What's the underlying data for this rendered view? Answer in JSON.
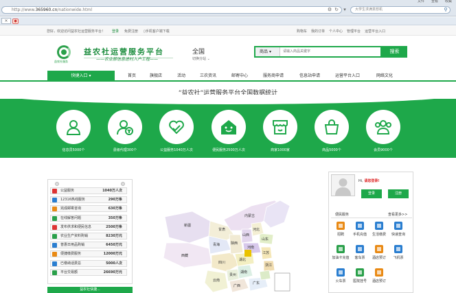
{
  "browser": {
    "menu": [
      "文件",
      "查看",
      "收藏"
    ],
    "url_prefix": "http://www.",
    "url_domain": "365960.cn",
    "url_path": "/nationwide.html",
    "search_placeholder": "大学生求满意想机",
    "fav_button": "×"
  },
  "topbar": {
    "welcome": "您好，欢迎访问益农社运营服务平台！",
    "login": "登录",
    "register": "免费注册",
    "app": "手机客户端下载",
    "right_links": [
      "购物车",
      "我的订单",
      "个人中心",
      "管理平台",
      "运营平台入口"
    ]
  },
  "header": {
    "logo_small": "益农社服务",
    "title": "益农社运营服务平台",
    "slogan": "——农业部信息进村入户工程——",
    "region": "全国",
    "region_switch": "切换分站"
  },
  "search": {
    "category": "商品",
    "placeholder": "请输入商品关键字",
    "button": "搜索"
  },
  "nav": {
    "quick": "快捷入口",
    "items": [
      "首页",
      "旗舰店",
      "活动",
      "三农资讯",
      "邮寄中心",
      "服务商申请",
      "信息站申请",
      "运营平台入口",
      "网络文化"
    ]
  },
  "stats": {
    "title": "“益农社“运营服务平台全国数据统计",
    "items": [
      {
        "label": "信息员5000个",
        "icon": "user-icon"
      },
      {
        "label": "县级代理300个",
        "icon": "money-user-icon"
      },
      {
        "label": "公益服务1040万人次",
        "icon": "heart-hand-icon"
      },
      {
        "label": "便民服务2500万人次",
        "icon": "house-icon"
      },
      {
        "label": "商家1000家",
        "icon": "store-icon"
      },
      {
        "label": "商品5000个",
        "icon": "bag-icon"
      },
      {
        "label": "会员9000个",
        "icon": "group-icon"
      }
    ]
  },
  "left_stats": [
    {
      "label": "公益服务",
      "value": "1040万人次",
      "color": "#d33"
    },
    {
      "label": "12316热线服务",
      "value": "290万条",
      "color": "#2a7ed0"
    },
    {
      "label": "完成邮寄咨询",
      "value": "630万条",
      "color": "#e98a15"
    },
    {
      "label": "在线解答问题",
      "value": "350万条",
      "color": "#2aa04a"
    },
    {
      "label": "发布供求和便民信息",
      "value": "2500万条",
      "color": "#d33"
    },
    {
      "label": "农业生产资料购销",
      "value": "8230万元",
      "color": "#2aa04a"
    },
    {
      "label": "普惠日用品购销",
      "value": "6450万元",
      "color": "#2a7ed0"
    },
    {
      "label": "便捷缴费服务",
      "value": "12000万元",
      "color": "#e98a15"
    },
    {
      "label": "已缴纳话费总",
      "value": "5000人次",
      "color": "#2a7ed0"
    },
    {
      "label": "平台交易额",
      "value": "26690万元",
      "color": "#2aa04a"
    }
  ],
  "left_footer": "益农社快捷...",
  "user": {
    "hi": "Hi,",
    "prompt": "请您登录!",
    "login": "登录",
    "register": "注册"
  },
  "services": {
    "tab": "便民服务",
    "more": "查看更多>>",
    "items": [
      {
        "label": "招聘",
        "color": "#e98a15"
      },
      {
        "label": "手机充值",
        "color": "#2a7ed0"
      },
      {
        "label": "生活缴费",
        "color": "#2a7ed0"
      },
      {
        "label": "快递查询",
        "color": "#2a7ed0"
      },
      {
        "label": "加油卡充值",
        "color": "#2aa04a"
      },
      {
        "label": "客车票",
        "color": "#2a7ed0"
      },
      {
        "label": "酒店预订",
        "color": "#e98a15"
      },
      {
        "label": "飞机票",
        "color": "#2a7ed0"
      },
      {
        "label": "火车票",
        "color": "#2a7ed0"
      },
      {
        "label": "医院挂号",
        "color": "#2aa04a"
      },
      {
        "label": "酒店预订",
        "color": "#e98a15"
      }
    ]
  },
  "map": {
    "labels": [
      "新疆",
      "西藏",
      "青海",
      "甘肃",
      "内蒙古",
      "四川",
      "云南",
      "贵州",
      "广西",
      "广东",
      "湖南",
      "湖北",
      "河南",
      "山东",
      "江苏",
      "浙江",
      "陕西",
      "山西",
      "河北"
    ]
  },
  "colors": {
    "brand": "#1ea84a",
    "accent": "#d22"
  }
}
